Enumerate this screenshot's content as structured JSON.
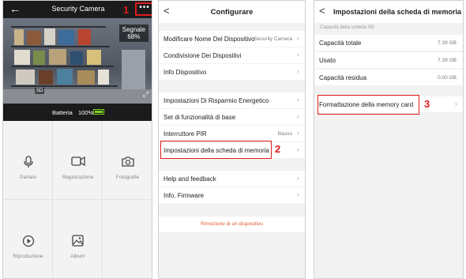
{
  "panel1": {
    "title": "Security Camera",
    "back_glyph": "←",
    "more_glyph": "•••",
    "step_marker": "1",
    "signal_label": "Segnale",
    "signal_value": "68%",
    "sd_label": "SD",
    "battery_label": "Batteria",
    "battery_value": "100%",
    "battery_level": 1.0,
    "actions": [
      {
        "label": "Parlare",
        "icon": "microphone-icon",
        "glyph": "🎙"
      },
      {
        "label": "Registrazione",
        "icon": "video-camera-icon",
        "glyph": "📹"
      },
      {
        "label": "Fotografie",
        "icon": "camera-icon",
        "glyph": "📷"
      },
      {
        "label": "Riproduzione",
        "icon": "playback-icon",
        "glyph": "▶"
      },
      {
        "label": "Album",
        "icon": "album-icon",
        "glyph": "🖼"
      }
    ]
  },
  "panel2": {
    "title": "Configurare",
    "back_glyph": "<",
    "step_marker": "2",
    "items": [
      {
        "label": "Modificare Nome Del Dispositivo",
        "value": "Security Camera"
      },
      {
        "label": "Condivisione Dei Dispositivi",
        "value": ""
      },
      {
        "label": "Info Dispositivo",
        "value": ""
      },
      {
        "label": "Impostazioni Di Risparmio Energetico",
        "value": ""
      },
      {
        "label": "Set di funzionalità di base",
        "value": ""
      },
      {
        "label": "Interruttore PIR",
        "value": "Basso"
      },
      {
        "label": "Impostazioni della scheda di memoria",
        "value": ""
      },
      {
        "label": "Help and feedback",
        "value": ""
      },
      {
        "label": "Info. Firmware",
        "value": ""
      }
    ],
    "remove_label": "Rimozione di un dispositivo"
  },
  "panel3": {
    "title": "Impostazioni della scheda di memoria",
    "back_glyph": "<",
    "section_label": "Capacità della scheda SD",
    "step_marker": "3",
    "rows": [
      {
        "label": "Capacità totale",
        "value": "7.39 GB"
      },
      {
        "label": "Usato",
        "value": "7.39 GB"
      },
      {
        "label": "Capacità residua",
        "value": "0.00 GB"
      }
    ],
    "format_label": "Formattazione della memory card"
  },
  "colors": {
    "accent_red": "#e01b1b",
    "battery_green": "#7ed321",
    "dark_bar": "#1b1b1b",
    "remove_orange": "#e05a2b"
  }
}
